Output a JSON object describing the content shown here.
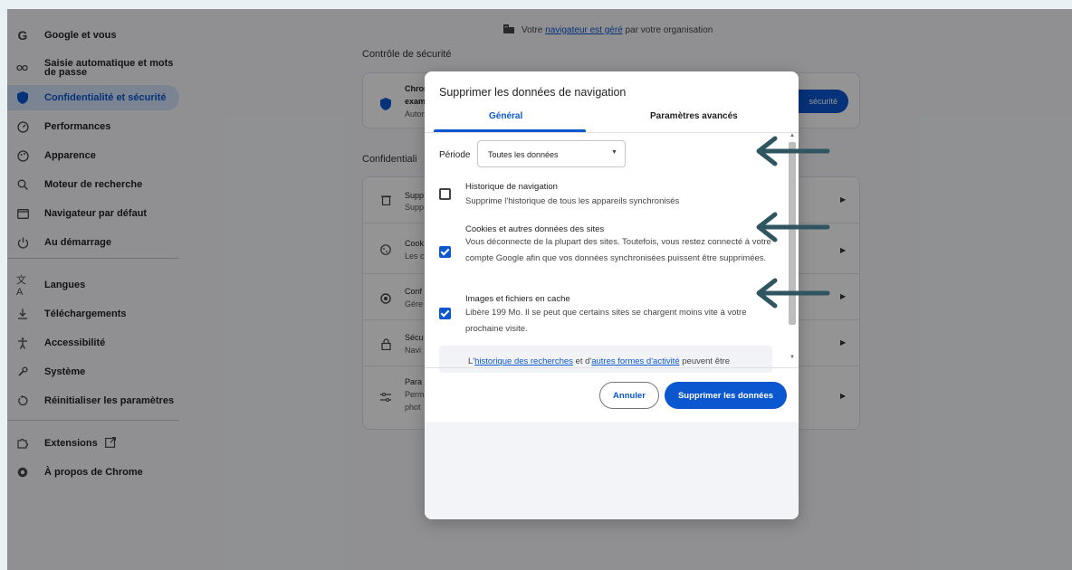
{
  "colors": {
    "accent": "#0b57d0",
    "annotation_arrow": "#2e5560",
    "overlay": "rgba(0,0,0,0.42)"
  },
  "banner": {
    "before": "Votre",
    "link": "navigateur est géré",
    "after": "par votre organisation",
    "icon": "building-icon"
  },
  "sidebar": {
    "logo": "G",
    "items": [
      {
        "label": "Google et vous",
        "icon": "google-icon"
      },
      {
        "label": "Saisie automatique et mots de passe",
        "icon": "key-icon"
      },
      {
        "label": "Confidentialité et sécurité",
        "icon": "shield-icon",
        "active": true
      },
      {
        "label": "Performances",
        "icon": "speedometer-icon"
      },
      {
        "label": "Apparence",
        "icon": "palette-icon"
      },
      {
        "label": "Moteur de recherche",
        "icon": "search-icon"
      },
      {
        "label": "Navigateur par défaut",
        "icon": "browser-icon"
      },
      {
        "label": "Au démarrage",
        "icon": "power-icon"
      },
      {
        "label": "Langues",
        "icon": "translate-icon"
      },
      {
        "label": "Téléchargements",
        "icon": "download-icon"
      },
      {
        "label": "Accessibilité",
        "icon": "accessibility-icon"
      },
      {
        "label": "Système",
        "icon": "wrench-icon"
      },
      {
        "label": "Réinitialiser les paramètres",
        "icon": "reset-icon"
      },
      {
        "label": "Extensions",
        "icon": "puzzle-icon"
      },
      {
        "label": "À propos de Chrome",
        "icon": "chrome-icon"
      }
    ]
  },
  "main": {
    "safety_title": "Contrôle de sécurité",
    "safety_row": {
      "line1": "Chron",
      "line2": "exam",
      "line3": "Autor"
    },
    "safety_button": "sécurité",
    "privacy_title": "Confidentiali",
    "rows": [
      {
        "line1": "Supp",
        "line2": "Supp",
        "icon": "trash-icon"
      },
      {
        "line1": "Cook",
        "line2": "Les c",
        "icon": "cookie-icon"
      },
      {
        "line1": "Conf",
        "line2": "Gére",
        "icon": "privacy-guide-icon"
      },
      {
        "line1": "Sécu",
        "line2": "Navi",
        "icon": "lock-icon"
      },
      {
        "line1": "Para",
        "line2": "Perm",
        "line3": "phot",
        "icon": "sliders-icon"
      }
    ]
  },
  "dialog": {
    "title": "Supprimer les données de navigation",
    "tabs": [
      "Général",
      "Paramètres avancés"
    ],
    "period_label": "Période",
    "period_value": "Toutes les données",
    "options": [
      {
        "title": "Historique de navigation",
        "desc": "Supprime l'historique de tous les appareils synchronisés",
        "checked": false
      },
      {
        "title": "Cookies et autres données des sites",
        "desc": "Vous déconnecte de la plupart des sites. Toutefois, vous restez connecté à votre compte Google afin que vos données synchronisées puissent être supprimées.",
        "checked": true
      },
      {
        "title": "Images et fichiers en cache",
        "desc": "Libère 199 Mo. Il se peut que certains sites se chargent moins vite à votre prochaine visite.",
        "checked": true
      }
    ],
    "info": {
      "prefix": "L'",
      "link1": "historique des recherches",
      "middle": " et d'",
      "link2": "autres formes d'activité",
      "suffix": " peuvent être"
    },
    "cancel": "Annuler",
    "confirm": "Supprimer les données"
  }
}
